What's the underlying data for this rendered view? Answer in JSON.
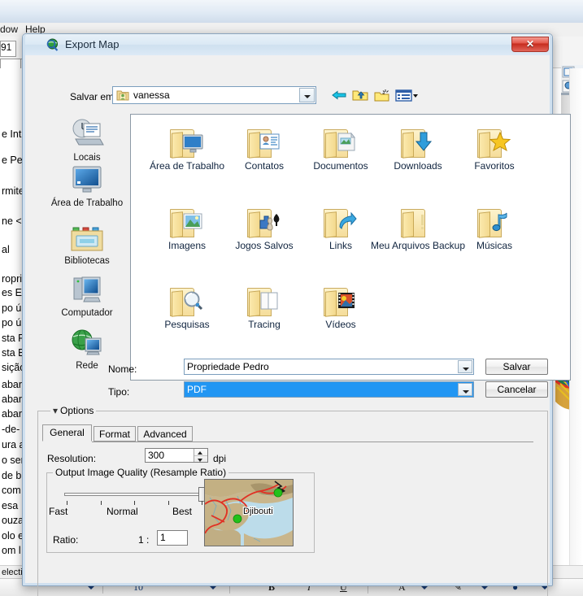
{
  "background": {
    "menu_items": [
      {
        "label": "dow",
        "x": 0
      },
      {
        "label": "Help",
        "x": 30
      }
    ],
    "toolbar_value": "91",
    "doc_lines": [
      "e Int",
      "e Pe",
      "rmite",
      "ne <",
      "al",
      "ropri",
      "es En",
      "po ú",
      "po ú",
      "sta P",
      "sta E",
      "sição",
      "abar",
      "abar",
      "abar",
      "-de-",
      "ura a",
      "o sen",
      " de b",
      " com",
      "esa",
      "ouza",
      "olo e",
      "om l"
    ],
    "status_text": "electi",
    "format_bar": {
      "font_size": "10",
      "bold": "B",
      "italic": "I",
      "underline": "U",
      "font_color": "A",
      "highlight": "✎",
      "bullet": "●"
    }
  },
  "dialog": {
    "title": "Export Map",
    "title_icon": "globe-search-icon",
    "close_label": "✕",
    "save_in": {
      "label": "Salvar em:",
      "value": "vanessa",
      "icon": "user-folder-icon"
    },
    "nav_buttons": [
      {
        "name": "back-button",
        "icon": "left-arrow-icon"
      },
      {
        "name": "up-one-level-button",
        "icon": "folder-up-icon"
      },
      {
        "name": "new-folder-button",
        "icon": "new-folder-icon"
      },
      {
        "name": "views-button",
        "icon": "views-list-icon"
      }
    ],
    "places": [
      {
        "label": "Locais",
        "icon": "recent-places-icon"
      },
      {
        "label": "Área de Trabalho",
        "icon": "desktop-icon"
      },
      {
        "label": "Bibliotecas",
        "icon": "libraries-icon"
      },
      {
        "label": "Computador",
        "icon": "computer-icon"
      },
      {
        "label": "Rede",
        "icon": "network-icon"
      }
    ],
    "files": [
      {
        "label": "Área de Trabalho",
        "icon": "folder-desktop-icon"
      },
      {
        "label": "Contatos",
        "icon": "folder-contacts-icon"
      },
      {
        "label": "Documentos",
        "icon": "folder-documents-icon"
      },
      {
        "label": "Downloads",
        "icon": "folder-downloads-icon"
      },
      {
        "label": "Favoritos",
        "icon": "folder-favorites-icon"
      },
      {
        "label": "Imagens",
        "icon": "folder-pictures-icon"
      },
      {
        "label": "Jogos Salvos",
        "icon": "folder-saved-games-icon"
      },
      {
        "label": "Links",
        "icon": "folder-links-icon"
      },
      {
        "label": "Meu Arquivos Backup",
        "icon": "folder-generic-icon"
      },
      {
        "label": "Músicas",
        "icon": "folder-music-icon"
      },
      {
        "label": "Pesquisas",
        "icon": "folder-searches-icon"
      },
      {
        "label": "Tracing",
        "icon": "folder-tracing-icon"
      },
      {
        "label": "Vídeos",
        "icon": "folder-videos-icon"
      }
    ],
    "name_row": {
      "label": "Nome:",
      "value": "Propriedade Pedro"
    },
    "type_row": {
      "label": "Tipo:",
      "value": "PDF"
    },
    "save_button": "Salvar",
    "cancel_button": "Cancelar",
    "options": {
      "group_title": "Options",
      "tabs": [
        {
          "label": "General",
          "active": true
        },
        {
          "label": "Format",
          "active": false
        },
        {
          "label": "Advanced",
          "active": false
        }
      ],
      "resolution": {
        "label": "Resolution:",
        "value": "300",
        "unit": "dpi"
      },
      "quality": {
        "group_title": "Output Image Quality (Resample Ratio)",
        "slider_min_label": "Fast",
        "slider_mid_label": "Normal",
        "slider_max_label": "Best",
        "slider_position_percent": 100,
        "ratio_label": "Ratio:",
        "ratio_prefix": "1 :",
        "ratio_value": "1"
      },
      "preview": {
        "city_label": "Djibouti",
        "name": "map-preview-thumbnail"
      }
    }
  },
  "colors": {
    "accent_selection": "#2196f3",
    "dialog_chrome": "#cfe0ef",
    "close_button": "#c62b1d",
    "folder_yellow": "#f5dd9a",
    "map_water": "#bcdcea",
    "map_land": "#c8b488",
    "map_road": "#e03024",
    "marker_green": "#22c11a"
  }
}
